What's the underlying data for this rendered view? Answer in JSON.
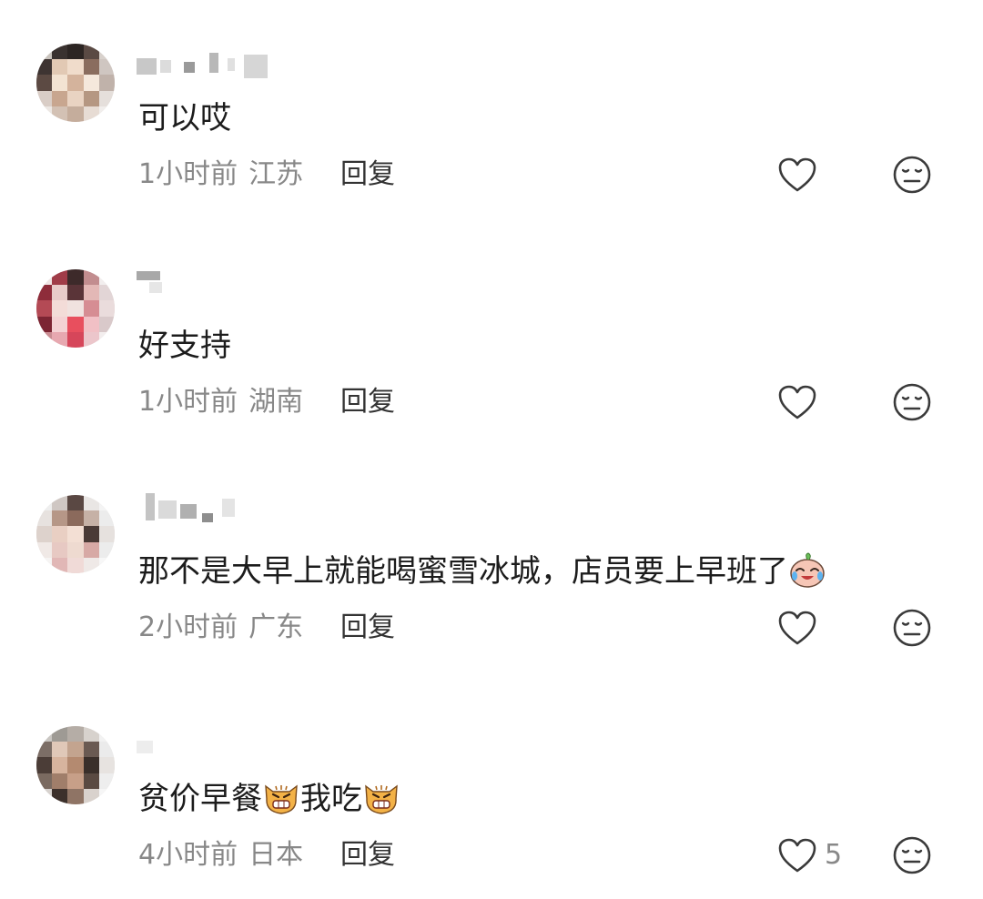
{
  "comments": [
    {
      "text": "可以哎",
      "time": "1小时前",
      "location": "江苏",
      "reply_label": "回复",
      "like_count": ""
    },
    {
      "text": "好支持",
      "time": "1小时前",
      "location": "湖南",
      "reply_label": "回复",
      "like_count": ""
    },
    {
      "text": "那不是大早上就能喝蜜雪冰城，店员要上早班了",
      "emoji_after": "crying-laugh-emoji",
      "time": "2小时前",
      "location": "广东",
      "reply_label": "回复",
      "like_count": ""
    },
    {
      "text_part1": "贫价早餐",
      "emoji_1": "angry-cat-emoji",
      "text_part2": "我吃",
      "emoji_2": "angry-cat-emoji",
      "time": "4小时前",
      "location": "日本",
      "reply_label": "回复",
      "like_count": "5"
    }
  ],
  "icons": {
    "like": "heart-outline-icon",
    "dislike": "meh-face-icon"
  },
  "colors": {
    "text": "#1c1c1c",
    "meta": "#888888",
    "reply": "#333333",
    "icon": "#3a3a3a"
  }
}
